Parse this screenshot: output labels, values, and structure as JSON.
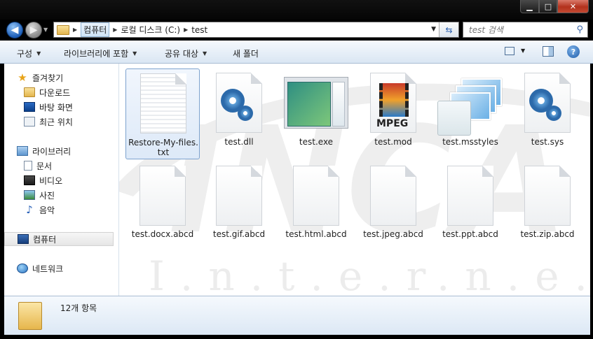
{
  "window": {
    "buttons": {
      "minimize": "▁",
      "maximize": "□",
      "close": "✕"
    }
  },
  "nav": {
    "back_icon": "arrow-left-icon",
    "forward_icon": "arrow-right-icon"
  },
  "address": {
    "segments": [
      "컴퓨터",
      "로컬 디스크 (C:)",
      "test"
    ]
  },
  "search": {
    "placeholder": "test 검색"
  },
  "toolbar": {
    "organize": "구성",
    "include_library": "라이브러리에 포함",
    "share": "공유 대상",
    "new_folder": "새 폴더"
  },
  "sidebar": {
    "favorites": {
      "label": "즐겨찾기",
      "items": [
        "다운로드",
        "바탕 화면",
        "최근 위치"
      ]
    },
    "libraries": {
      "label": "라이브러리",
      "items": [
        "문서",
        "비디오",
        "사진",
        "음악"
      ]
    },
    "computer": "컴퓨터",
    "network": "네트워크"
  },
  "watermark": "I.n.t.e.r.n.e.t",
  "files": [
    {
      "name": "Restore-My-files.txt",
      "line1": "Restore-My-files.",
      "line2": "txt",
      "icon": "text-file-icon"
    },
    {
      "name": "test.dll",
      "icon": "dll-gear-icon"
    },
    {
      "name": "test.exe",
      "icon": "exe-window-icon"
    },
    {
      "name": "test.mod",
      "icon": "mpeg-video-icon",
      "badge": "MPEG"
    },
    {
      "name": "test.msstyles",
      "icon": "msstyles-icon"
    },
    {
      "name": "test.sys",
      "icon": "sys-gear-icon"
    },
    {
      "name": "test.docx.abcd",
      "icon": "blank-file-icon"
    },
    {
      "name": "test.gif.abcd",
      "icon": "blank-file-icon"
    },
    {
      "name": "test.html.abcd",
      "icon": "blank-file-icon"
    },
    {
      "name": "test.jpeg.abcd",
      "icon": "blank-file-icon"
    },
    {
      "name": "test.ppt.abcd",
      "icon": "blank-file-icon"
    },
    {
      "name": "test.zip.abcd",
      "icon": "blank-file-icon"
    }
  ],
  "status": {
    "count": "12개 항목"
  }
}
